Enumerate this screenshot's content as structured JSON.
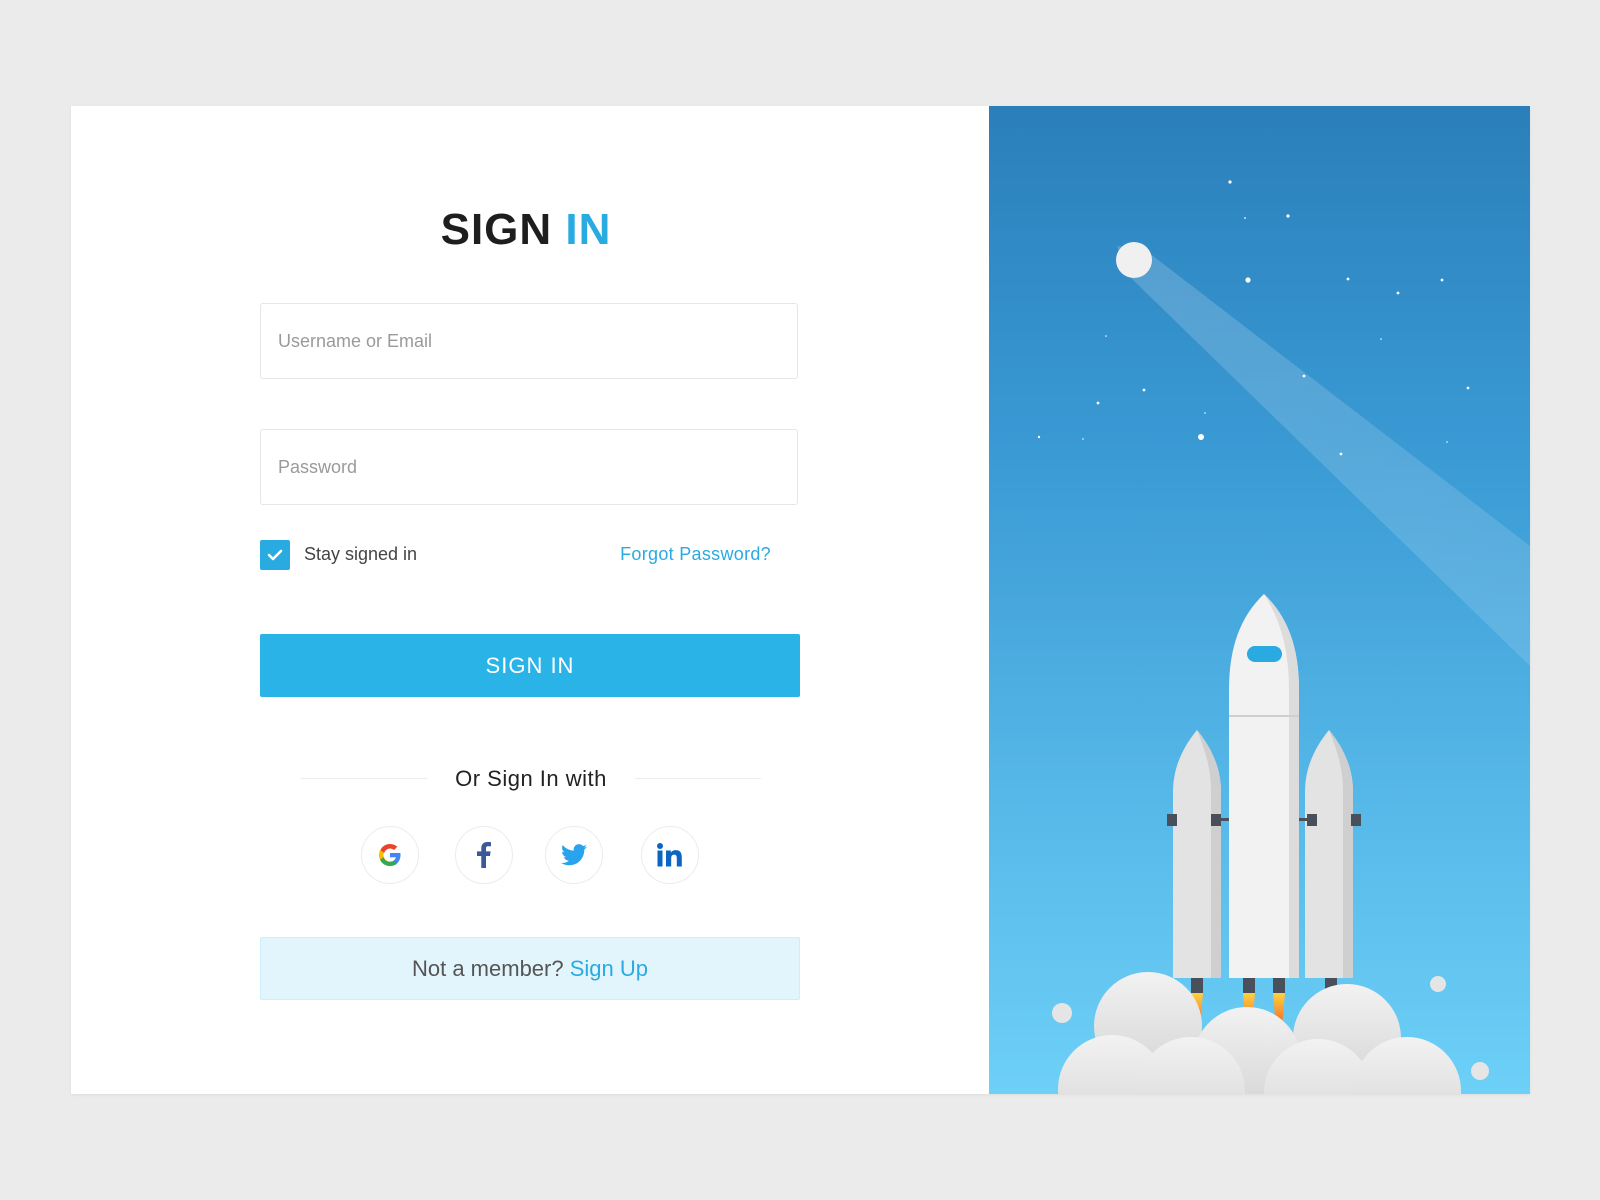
{
  "title": {
    "word1": "SIGN",
    "word2": "IN"
  },
  "form": {
    "username_placeholder": "Username or Email",
    "password_placeholder": "Password",
    "stay_signed_in_label": "Stay signed in",
    "stay_signed_in_checked": true,
    "forgot_password_label": "Forgot Password?",
    "sign_in_button_label": "SIGN IN"
  },
  "social": {
    "divider_text": "Or Sign In with",
    "providers": [
      {
        "name": "Google",
        "icon": "google-icon"
      },
      {
        "name": "Facebook",
        "icon": "facebook-icon"
      },
      {
        "name": "Twitter",
        "icon": "twitter-icon"
      },
      {
        "name": "LinkedIn",
        "icon": "linkedin-icon"
      }
    ]
  },
  "signup": {
    "prompt": "Not a member?",
    "link_label": "Sign Up"
  },
  "colors": {
    "accent": "#29abe2",
    "page_background": "#ebebeb",
    "illustration_sky_top": "#2a7fba",
    "illustration_sky_bottom": "#6dd0f7"
  },
  "illustration": {
    "subject": "rocket-launch",
    "icons": [
      "moon-icon",
      "star-icon",
      "rocket-icon",
      "smoke-cloud-icon"
    ]
  }
}
